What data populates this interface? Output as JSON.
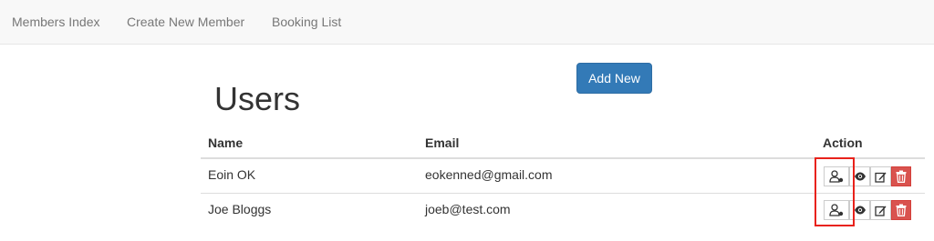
{
  "nav": {
    "items": [
      {
        "label": "Members Index"
      },
      {
        "label": "Create New Member"
      },
      {
        "label": "Booking List"
      }
    ]
  },
  "page": {
    "title": "Users",
    "add_button_label": "Add New"
  },
  "table": {
    "columns": [
      "Name",
      "Email",
      "Action"
    ],
    "rows": [
      {
        "name": "Eoin OK",
        "email": "eokenned@gmail.com"
      },
      {
        "name": "Joe Bloggs",
        "email": "joeb@test.com"
      }
    ],
    "action_icons": [
      "user-assign-icon",
      "eye-icon",
      "edit-icon",
      "trash-icon"
    ]
  },
  "colors": {
    "primary": "#337ab7",
    "danger": "#d9534f",
    "highlight": "#e8221b",
    "navbar_bg": "#f8f8f8"
  }
}
